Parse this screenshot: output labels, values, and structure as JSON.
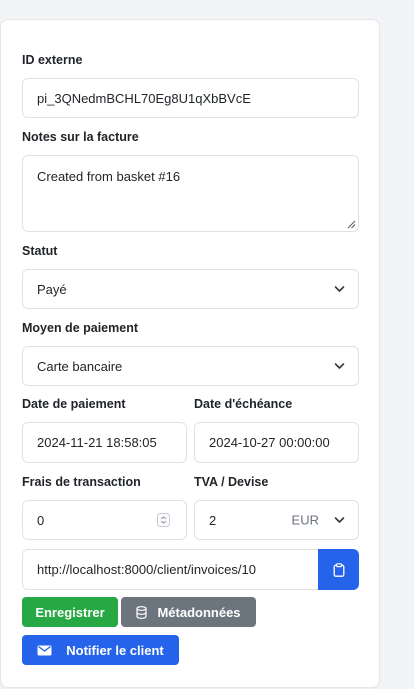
{
  "form": {
    "external_id": {
      "label": "ID externe",
      "value": "pi_3QNedmBCHL70Eg8U1qXbBVcE"
    },
    "invoice_notes": {
      "label": "Notes sur la facture",
      "value": "Created from basket #16"
    },
    "status": {
      "label": "Statut",
      "value": "Payé"
    },
    "payment_method": {
      "label": "Moyen de paiement",
      "value": "Carte bancaire"
    },
    "payment_date": {
      "label": "Date de paiement",
      "value": "2024-11-21 18:58:05"
    },
    "due_date": {
      "label": "Date d'échéance",
      "value": "2024-10-27 00:00:00"
    },
    "transaction_fees": {
      "label": "Frais de transaction",
      "value": "0"
    },
    "vat_currency": {
      "label": "TVA / Devise",
      "vat_value": "2",
      "currency": "EUR"
    },
    "invoice_url": {
      "value": "http://localhost:8000/client/invoices/10"
    }
  },
  "actions": {
    "save_label": "Enregistrer",
    "metadata_label": "Métadonnées",
    "notify_label": "Notifier le client"
  },
  "icons": {
    "copy": "clipboard-icon",
    "metadata": "database-icon",
    "notify": "envelope-icon",
    "select": "chevron-down-icon",
    "stepper": "number-stepper-icon"
  },
  "colors": {
    "primary": "#2563eb",
    "success": "#28a745",
    "secondary": "#6c757d",
    "border": "#dee2e6"
  }
}
